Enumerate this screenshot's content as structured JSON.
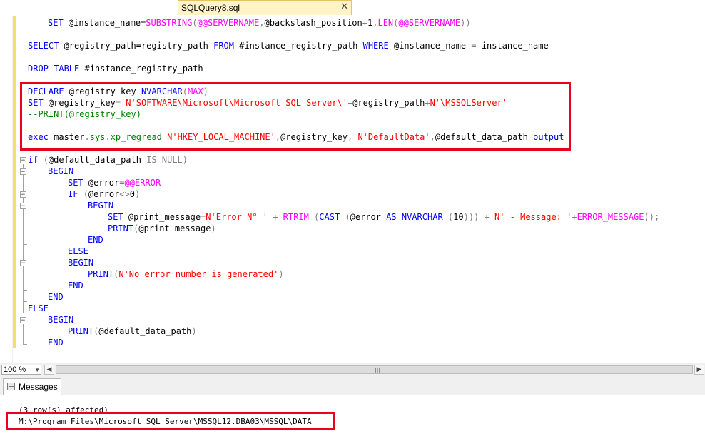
{
  "tab": {
    "title": "SQLQuery8.sql",
    "close": "✕"
  },
  "editor": {
    "lines": [
      {
        "segments": [
          [
            "kw",
            "SET "
          ],
          [
            "",
            "@instance_name="
          ],
          [
            "fn",
            "SUBSTRING"
          ],
          [
            "gray",
            "("
          ],
          [
            "fn",
            "@@SERVERNAME"
          ],
          [
            "gray",
            ","
          ],
          [
            "",
            "@backslash_position"
          ],
          [
            "gray",
            "+"
          ],
          [
            "",
            "1"
          ],
          [
            "gray",
            ","
          ],
          [
            "fn",
            "LEN"
          ],
          [
            "gray",
            "("
          ],
          [
            "fn",
            "@@SERVERNAME"
          ],
          [
            "gray",
            "))"
          ]
        ]
      },
      {
        "segments": [
          [
            "kw",
            "SELECT "
          ],
          [
            "",
            "@registry_path=registry_path "
          ],
          [
            "kw",
            "FROM "
          ],
          [
            "",
            "#instance_registry_path "
          ],
          [
            "kw",
            "WHERE "
          ],
          [
            "",
            "@instance_name "
          ],
          [
            "gray",
            "= "
          ],
          [
            "",
            "instance_name"
          ]
        ]
      },
      {
        "segments": [
          [
            "kw",
            "DROP TABLE "
          ],
          [
            "",
            "#instance_registry_path"
          ]
        ]
      },
      {
        "segments": [
          [
            "kw",
            "DECLARE "
          ],
          [
            "",
            "@registry_key "
          ],
          [
            "kw",
            "NVARCHAR"
          ],
          [
            "gray",
            "("
          ],
          [
            "fn",
            "MAX"
          ],
          [
            "gray",
            ")"
          ]
        ]
      },
      {
        "segments": [
          [
            "kw",
            "SET "
          ],
          [
            "",
            "@registry_key"
          ],
          [
            "gray",
            "= "
          ],
          [
            "str",
            "N'SOFTWARE\\Microsoft\\Microsoft SQL Server\\'"
          ],
          [
            "gray",
            "+"
          ],
          [
            "",
            "@registry_path"
          ],
          [
            "gray",
            "+"
          ],
          [
            "str",
            "N'\\MSSQLServer'"
          ]
        ]
      },
      {
        "segments": [
          [
            "cmt",
            "--PRINT(@registry_key)"
          ]
        ]
      },
      {
        "segments": [
          [
            "kw",
            "exec "
          ],
          [
            "",
            "master"
          ],
          [
            "gray",
            "."
          ],
          [
            "sys",
            "sys"
          ],
          [
            "gray",
            "."
          ],
          [
            "sys",
            "xp_regread "
          ],
          [
            "str",
            "N'HKEY_LOCAL_MACHINE'"
          ],
          [
            "gray",
            ","
          ],
          [
            "",
            "@registry_key"
          ],
          [
            "gray",
            ", "
          ],
          [
            "str",
            "N'DefaultData'"
          ],
          [
            "gray",
            ","
          ],
          [
            "",
            "@default_data_path "
          ],
          [
            "kw",
            "output"
          ]
        ]
      },
      {
        "segments": [
          [
            "kw",
            "if "
          ],
          [
            "gray",
            "("
          ],
          [
            "",
            "@default_data_path "
          ],
          [
            "gray",
            "IS NULL)"
          ]
        ]
      },
      {
        "segments": [
          [
            "kw",
            "BEGIN"
          ]
        ]
      },
      {
        "segments": [
          [
            "kw",
            "SET "
          ],
          [
            "",
            "@error"
          ],
          [
            "gray",
            "="
          ],
          [
            "fn",
            "@@ERROR"
          ]
        ]
      },
      {
        "segments": [
          [
            "kw",
            "IF "
          ],
          [
            "gray",
            "("
          ],
          [
            "",
            "@error"
          ],
          [
            "gray",
            "<>"
          ],
          [
            "",
            "0"
          ],
          [
            "gray",
            ")"
          ]
        ]
      },
      {
        "segments": [
          [
            "kw",
            "BEGIN"
          ]
        ]
      },
      {
        "segments": [
          [
            "kw",
            "SET "
          ],
          [
            "",
            "@print_message"
          ],
          [
            "gray",
            "="
          ],
          [
            "str",
            "N'Error N° ' "
          ],
          [
            "gray",
            "+ "
          ],
          [
            "fn",
            "RTRIM "
          ],
          [
            "gray",
            "("
          ],
          [
            "kw",
            "CAST "
          ],
          [
            "gray",
            "("
          ],
          [
            "",
            "@error "
          ],
          [
            "kw",
            "AS NVARCHAR "
          ],
          [
            "gray",
            "("
          ],
          [
            "",
            "10"
          ],
          [
            "gray",
            ")))"
          ],
          [
            "gray",
            " + "
          ],
          [
            "str",
            "N' - Message: '"
          ],
          [
            "gray",
            "+"
          ],
          [
            "fn",
            "ERROR_MESSAGE"
          ],
          [
            "gray",
            "();"
          ]
        ]
      },
      {
        "segments": [
          [
            "kw",
            "PRINT"
          ],
          [
            "gray",
            "("
          ],
          [
            "",
            "@print_message"
          ],
          [
            "gray",
            ")"
          ]
        ]
      },
      {
        "segments": [
          [
            "kw",
            "END"
          ]
        ]
      },
      {
        "segments": [
          [
            "kw",
            "ELSE"
          ]
        ]
      },
      {
        "segments": [
          [
            "kw",
            "BEGIN"
          ]
        ]
      },
      {
        "segments": [
          [
            "kw",
            "PRINT"
          ],
          [
            "gray",
            "("
          ],
          [
            "str",
            "N'No error number is generated'"
          ],
          [
            "gray",
            ")"
          ]
        ]
      },
      {
        "segments": [
          [
            "kw",
            "END"
          ]
        ]
      },
      {
        "segments": [
          [
            "kw",
            "END"
          ]
        ]
      },
      {
        "segments": [
          [
            "kw",
            "ELSE"
          ]
        ]
      },
      {
        "segments": [
          [
            "kw",
            "BEGIN"
          ]
        ]
      },
      {
        "segments": [
          [
            "kw",
            "PRINT"
          ],
          [
            "gray",
            "("
          ],
          [
            "",
            "@default_data_path"
          ],
          [
            "gray",
            ")"
          ]
        ]
      },
      {
        "segments": [
          [
            "kw",
            "END"
          ]
        ]
      }
    ]
  },
  "zoom": {
    "value": "100 %"
  },
  "results": {
    "tab_label": "Messages",
    "messages": [
      "(3 row(s) affected)",
      "M:\\Program Files\\Microsoft SQL Server\\MSSQL12.DBA03\\MSSQL\\DATA"
    ]
  },
  "colors": {
    "keyword": "#0000ff",
    "function": "#ff00ff",
    "string": "#ff0000",
    "comment": "#008000",
    "operator": "#808080",
    "highlight": "#e8001c"
  }
}
